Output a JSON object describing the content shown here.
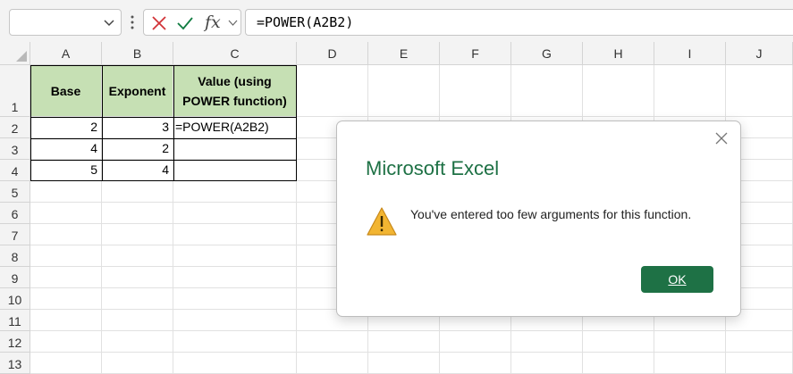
{
  "formula_bar": {
    "name_box_value": "",
    "formula": "=POWER(A2B2)",
    "fx_label": "fx"
  },
  "columns": [
    "A",
    "B",
    "C",
    "D",
    "E",
    "F",
    "G",
    "H",
    "I",
    "J"
  ],
  "rows": [
    "1",
    "2",
    "3",
    "4",
    "5",
    "6",
    "7",
    "8",
    "9",
    "10",
    "11",
    "12",
    "13"
  ],
  "table": {
    "headers": [
      "Base",
      "Exponent",
      "Value (using POWER function)"
    ],
    "data": [
      [
        "2",
        "3",
        "=POWER(A2B2)"
      ],
      [
        "4",
        "2",
        ""
      ],
      [
        "5",
        "4",
        ""
      ]
    ]
  },
  "dialog": {
    "title": "Microsoft Excel",
    "message": "You've entered too few arguments for this function.",
    "ok_label": "OK"
  },
  "colors": {
    "header_fill": "#c6e0b4",
    "excel_green": "#1e7145",
    "warning": "#f2b532"
  }
}
